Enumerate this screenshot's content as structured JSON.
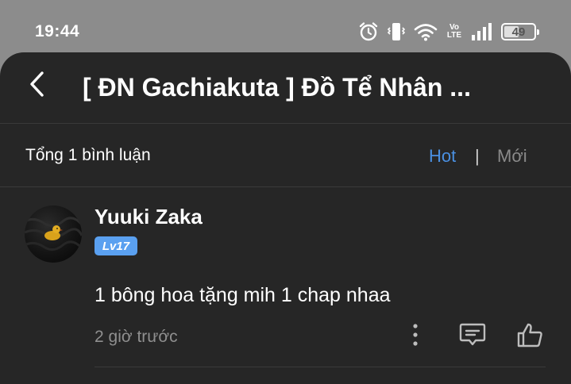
{
  "status_bar": {
    "time": "19:44",
    "icons": [
      "alarm-icon",
      "vibrate-icon",
      "wifi-icon",
      "volte-icon",
      "signal-icon",
      "battery-icon"
    ],
    "volte_top": "Vo",
    "volte_bottom": "LTE",
    "battery_percent": 49,
    "battery_label": "49"
  },
  "header": {
    "back_icon": "back-arrow-icon",
    "title": "[ ĐN Gachiakuta ] Đồ Tể Nhân ..."
  },
  "comments_bar": {
    "count_label": "Tổng 1 bình luận",
    "sort_hot": "Hot",
    "sort_divider": "|",
    "sort_new": "Mới",
    "active_color": "#4a90e2"
  },
  "comments": [
    {
      "username": "Yuuki Zaka",
      "level": "Lv17",
      "text": "1 bông hoa tặng mih 1 chap nhaa",
      "time": "2 giờ trước",
      "actions": [
        "more-icon",
        "reply-icon",
        "like-icon"
      ]
    }
  ]
}
